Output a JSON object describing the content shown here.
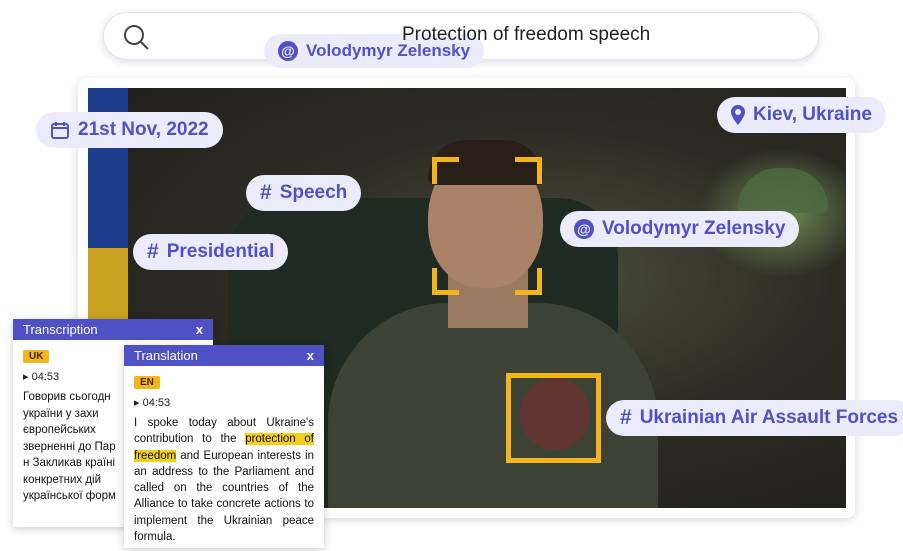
{
  "search": {
    "person_chip": "Volodymyr Zelensky",
    "query": "Protection of freedom speech"
  },
  "tags": {
    "date": "21st Nov, 2022",
    "location": "Kiev, Ukraine",
    "speech": "Speech",
    "presidential": "Presidential",
    "person": "Volodymyr Zelensky",
    "unit": "Ukrainian Air Assault Forces"
  },
  "transcription": {
    "title": "Transcription",
    "close": "x",
    "lang": "UK",
    "time": "▸ 04:53",
    "lines": [
      "Говорив сьогодн",
      "україни у захи",
      "європейських",
      "зверненні до Пар",
      "н Закликав країні",
      "конкретних дій",
      "української форм"
    ]
  },
  "translation": {
    "title": "Translation",
    "close": "x",
    "lang": "EN",
    "time": "▸ 04:53",
    "text_before": "I spoke today about Ukraine's contribution to the ",
    "highlight": "protection of freedom",
    "text_after": " and European interests in an address to the Parliament and called on the countries of the Alliance to take concrete actions to implement the Ukrainian peace formula."
  },
  "colors": {
    "accent": "#5151c6",
    "chip_bg": "#ecebfb",
    "highlight": "#f3b51a"
  },
  "icons": [
    "search-icon",
    "at-icon",
    "calendar-icon",
    "location-pin-icon",
    "hash-icon",
    "close-icon"
  ]
}
